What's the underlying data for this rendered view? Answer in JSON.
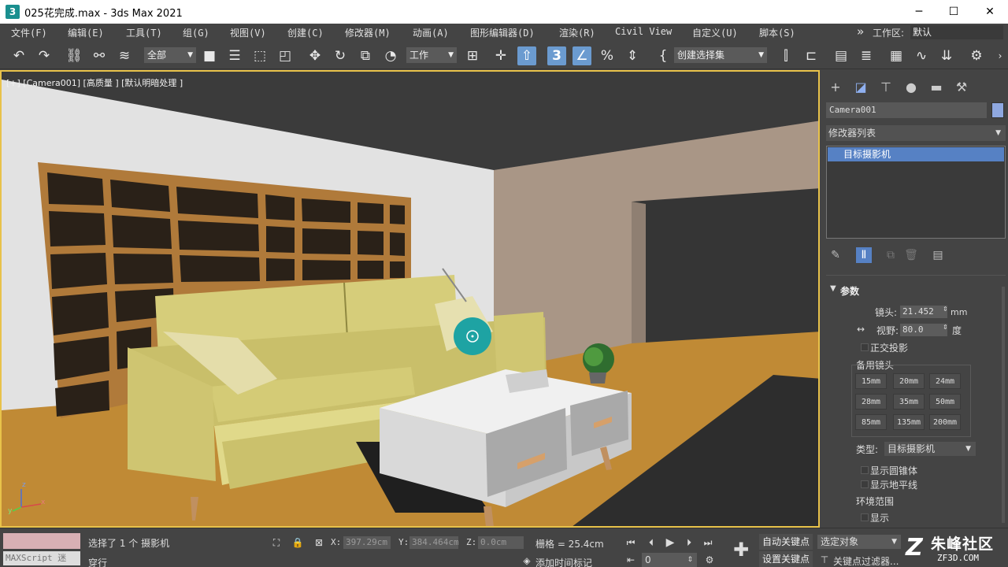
{
  "window": {
    "title": "025花完成.max - 3ds Max 2021",
    "minimize": "─",
    "maximize": "☐",
    "close": "✕"
  },
  "menu": {
    "items": [
      "文件(F)",
      "编辑(E)",
      "工具(T)",
      "组(G)",
      "视图(V)",
      "创建(C)",
      "修改器(M)",
      "动画(A)",
      "图形编辑器(D)",
      "渲染(R)",
      "Civil View",
      "自定义(U)",
      "脚本(S)"
    ],
    "overflow": "»",
    "workspace_label": "工作区:",
    "workspace_value": "默认"
  },
  "toolbar": {
    "filter_value": "全部",
    "reference_coord": "工作",
    "snap_value": "3",
    "selection_set": "创建选择集"
  },
  "viewport": {
    "label": "[+] [Camera001] [高质量 ] [默认明暗处理 ]",
    "axis_z": "z",
    "axis_x": "x",
    "axis_y": "y"
  },
  "command_panel": {
    "object_name": "Camera001",
    "object_color": "#8fa8e0",
    "modifier_list": "修改器列表",
    "stack_item": "目标摄影机",
    "params": {
      "header": "参数",
      "lens_label": "镜头:",
      "lens_value": "21.452",
      "lens_unit": "mm",
      "fov_label": "视野:",
      "fov_value": "80.0",
      "fov_unit": "度",
      "ortho_label": "正交投影",
      "presets_label": "备用镜头",
      "presets": [
        "15mm",
        "20mm",
        "24mm",
        "28mm",
        "35mm",
        "50mm",
        "85mm",
        "135mm",
        "200mm"
      ],
      "type_label": "类型:",
      "type_value": "目标摄影机",
      "show_cone": "显示圆锥体",
      "show_horizon": "显示地平线",
      "env_range": "环境范围",
      "show": "显示"
    }
  },
  "statusbar": {
    "listener": "MAXScript 迷",
    "status_line1": "选择了 1 个 摄影机",
    "status_line2": "穿行",
    "x_label": "X:",
    "x_value": "397.29cm",
    "y_label": "Y:",
    "y_value": "384.464cm",
    "z_label": "Z:",
    "z_value": "0.0cm",
    "grid": "栅格 = 25.4cm",
    "add_time_tag": "添加时间标记",
    "frame_value": "0",
    "auto_key": "自动关键点",
    "set_key": "设置关键点",
    "selection_filter": "选定对象",
    "key_filters": "关键点过滤器..."
  },
  "watermark": {
    "name": "朱峰社区",
    "url": "ZF3D.COM"
  }
}
